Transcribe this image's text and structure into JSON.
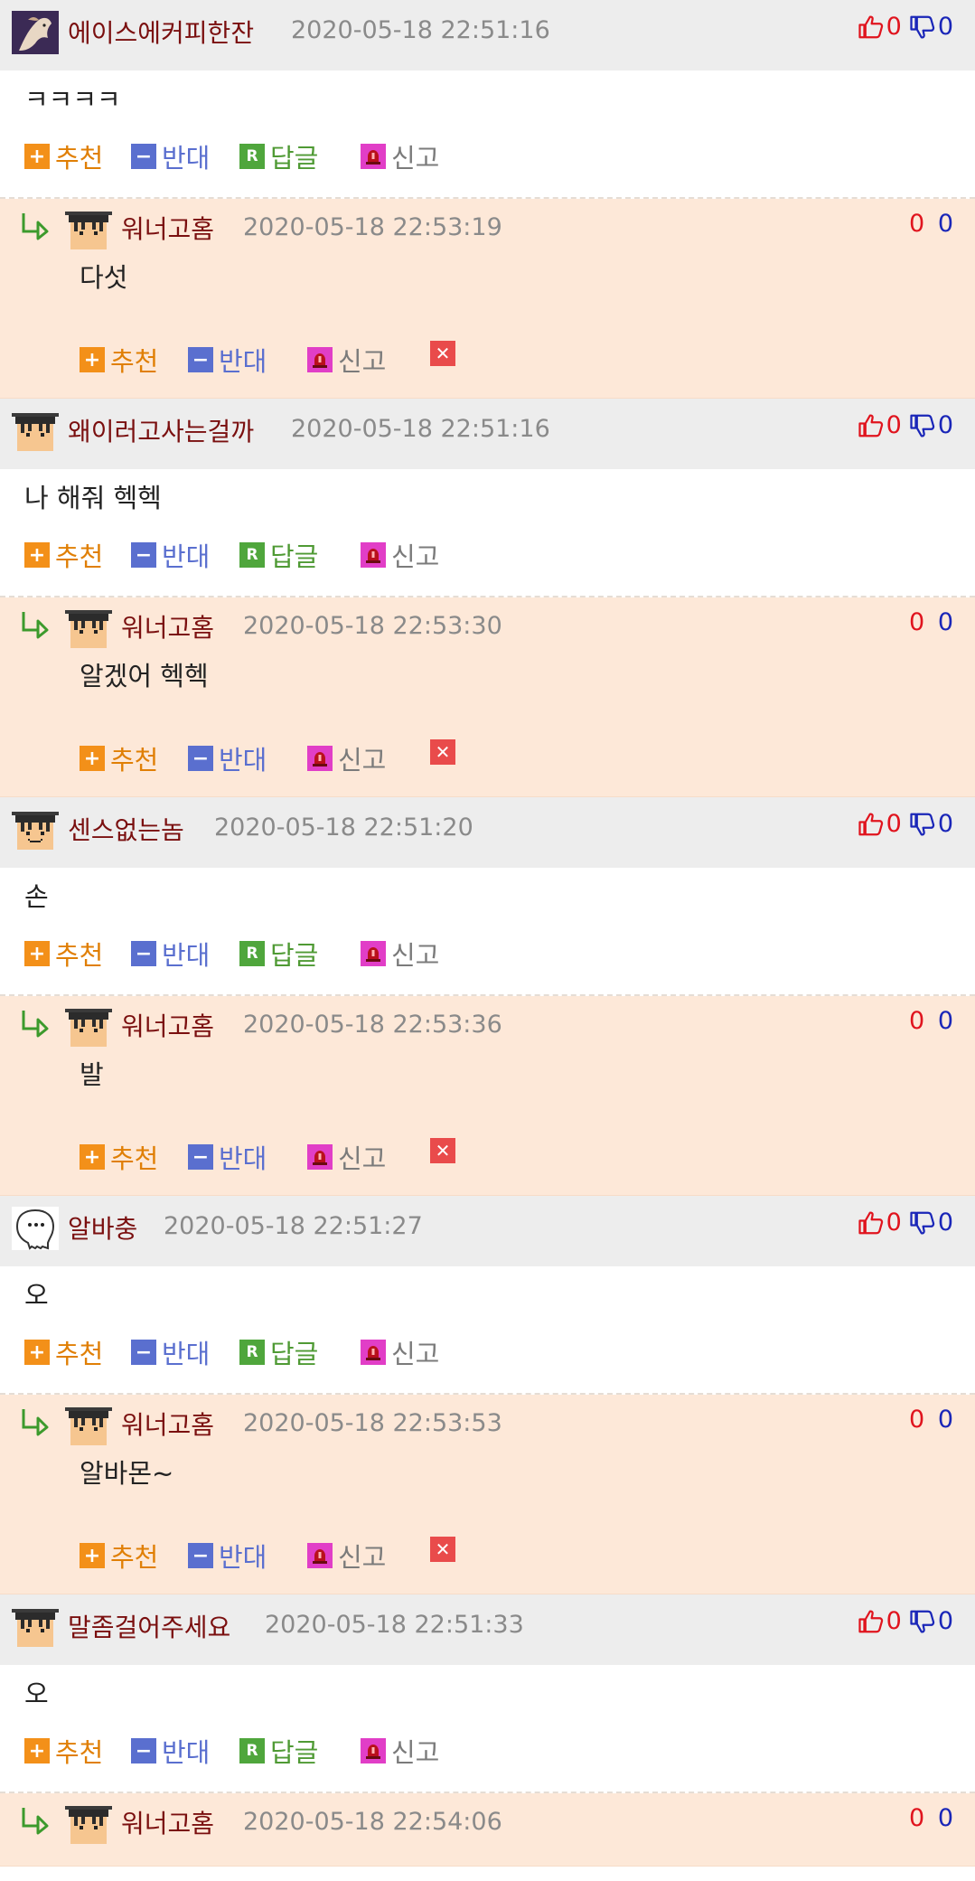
{
  "labels": {
    "recommend": "추천",
    "oppose": "반대",
    "reply": "답글",
    "report": "신고"
  },
  "colors": {
    "head_bg": "#ededed",
    "reply_bg": "#fde8d8",
    "nick": "#7a0f0f",
    "up_red": "#e0141e",
    "down_blue": "#1a26b8"
  },
  "comments": [
    {
      "nick": "에이스에커피한잔",
      "time": "2020-05-18 22:51:16",
      "avatar": "horse-photo",
      "up": "0",
      "down": "0",
      "body": "ㅋㅋㅋㅋ",
      "reply": {
        "nick": "워너고홈",
        "time": "2020-05-18 22:53:19",
        "up": "0",
        "down": "0",
        "body": "다섯"
      }
    },
    {
      "nick": "왜이러고사는걸까",
      "time": "2020-05-18 22:51:16",
      "avatar": "pixel-face",
      "up": "0",
      "down": "0",
      "body": "나 해줘 헥헥",
      "reply": {
        "nick": "워너고홈",
        "time": "2020-05-18 22:53:30",
        "up": "0",
        "down": "0",
        "body": "알겠어 헥헥"
      }
    },
    {
      "nick": "센스없는놈",
      "time": "2020-05-18 22:51:20",
      "avatar": "pixel-face-smile",
      "up": "0",
      "down": "0",
      "body": "손",
      "reply": {
        "nick": "워너고홈",
        "time": "2020-05-18 22:53:36",
        "up": "0",
        "down": "0",
        "body": "발"
      }
    },
    {
      "nick": "알바충",
      "time": "2020-05-18 22:51:27",
      "avatar": "ghost-doodle",
      "up": "0",
      "down": "0",
      "body": "오",
      "reply": {
        "nick": "워너고홈",
        "time": "2020-05-18 22:53:53",
        "up": "0",
        "down": "0",
        "body": "알바몬~"
      }
    },
    {
      "nick": "말좀걸어주세요",
      "time": "2020-05-18 22:51:33",
      "avatar": "pixel-face",
      "up": "0",
      "down": "0",
      "body": "오",
      "reply": {
        "nick": "워너고홈",
        "time": "2020-05-18 22:54:06",
        "up": "0",
        "down": "0",
        "body": ""
      }
    }
  ]
}
